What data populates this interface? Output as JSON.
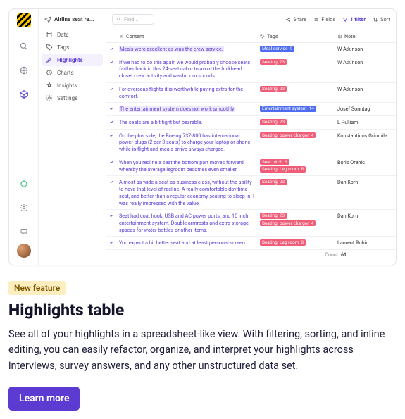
{
  "project_title": "Airline seat re...",
  "nav": [
    {
      "label": "Data",
      "icon": "database-icon",
      "active": false
    },
    {
      "label": "Tags",
      "icon": "tag-icon",
      "active": false
    },
    {
      "label": "Highlights",
      "icon": "highlight-icon",
      "active": true
    },
    {
      "label": "Charts",
      "icon": "chart-icon",
      "active": false
    },
    {
      "label": "Insights",
      "icon": "insight-icon",
      "active": false
    },
    {
      "label": "Settings",
      "icon": "settings-icon",
      "active": false
    }
  ],
  "search_placeholder": "Find...",
  "toolbar": {
    "share": "Share",
    "fields": "Fields",
    "filter": "1 filter",
    "sort": "Sort"
  },
  "columns": {
    "content": "Content",
    "tags": "Tags",
    "note": "Note"
  },
  "tag_colors": {
    "Meal service": "#4e6cf0",
    "Seating": "#ef5d78",
    "Entertainment system": "#4e6cf0",
    "Seating: power charger": "#ef5d78",
    "Seat pitch": "#ef5d78",
    "Seating: Leg room": "#ef5d78"
  },
  "rows": [
    {
      "content": "Meals were excellent as was the crew service.",
      "highlighted": true,
      "tags": [
        {
          "name": "Meal service",
          "count": 9
        }
      ],
      "note": "W Atkinson"
    },
    {
      "content": "If we had to do this again we would probably choose seats farther back in this 24-seat cabin to avoid the bulkhead closet crew activity and washroom sounds.",
      "highlighted": false,
      "tags": [
        {
          "name": "Seating",
          "count": 23
        }
      ],
      "note": "W Atkinson"
    },
    {
      "content": "For overseas flights it is worthwhile paying extra for the comfort.",
      "highlighted": false,
      "tags": [
        {
          "name": "Seating",
          "count": 23
        }
      ],
      "note": "W Atkinson"
    },
    {
      "content": "The entertainment system does not work smoothly",
      "highlighted": true,
      "tags": [
        {
          "name": "Entertainment system",
          "count": 14
        }
      ],
      "note": "Josef Sonntag"
    },
    {
      "content": "The seats are a bit tight but bearable.",
      "highlighted": false,
      "tags": [
        {
          "name": "Seating",
          "count": 23
        }
      ],
      "note": "L Pulliam"
    },
    {
      "content": "On the plus side, the Boeing 737-800 has international power plugs (2 per 3 seats) to charge your laptop or phone while in flight and meals arrive always charged.",
      "highlighted": false,
      "tags": [
        {
          "name": "Seating: power charger",
          "count": 4
        }
      ],
      "note": "Konstantinos Grimpilakos"
    },
    {
      "content": "When you recline a seat the bottom part moves forward whereby the average legroom becomes even smaller.",
      "highlighted": false,
      "tags": [
        {
          "name": "Seat pitch",
          "count": 6
        },
        {
          "name": "Seating: Leg room",
          "count": 8
        }
      ],
      "note": "Boris Orenic"
    },
    {
      "content": "Almost as wide a seat as business class, without the ability to have that level of recline. A really comfortable day time seat, and better than a regular economy seating to sleep in. I was really impressed with the value.",
      "highlighted": false,
      "tags": [
        {
          "name": "Seating",
          "count": 23
        }
      ],
      "note": "Dan Korn"
    },
    {
      "content": "Seat had coat hook, USB and AC power ports, and 10 inch entertainment system. Double armrests and extra storage spaces for water bottles or other items.",
      "highlighted": false,
      "tags": [
        {
          "name": "Seating",
          "count": 23
        },
        {
          "name": "Seating: power charger",
          "count": 4
        }
      ],
      "note": "Dan Korn"
    },
    {
      "content": "You expect a bit better seat and at least personal screen",
      "highlighted": false,
      "tags": [
        {
          "name": "Seating: Leg room",
          "count": 8
        }
      ],
      "note": "Laurent Robin"
    }
  ],
  "count_label": "Count",
  "count_value": "61",
  "promo": {
    "badge": "New feature",
    "title": "Highlights table",
    "body": "See all of your highlights in a spreadsheet-like view. With filtering, sorting, and inline editing, you can easily refactor, organize, and interpret your highlights across interviews, survey answers, and any other unstructured data set.",
    "cta": "Learn more"
  }
}
